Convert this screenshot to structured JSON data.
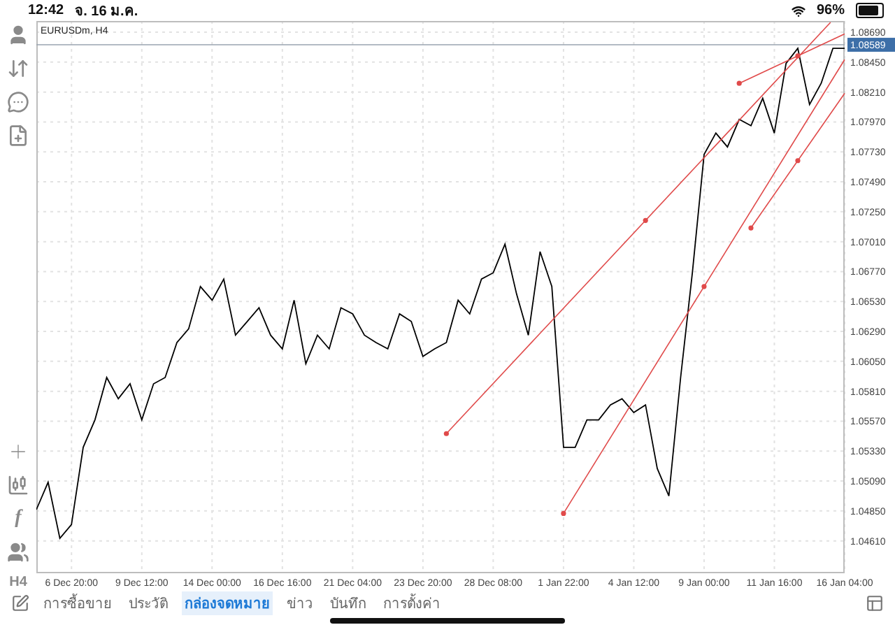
{
  "status_bar": {
    "time": "12:42",
    "date": "จ. 16 ม.ค.",
    "battery": "96%"
  },
  "left_toolbar": {
    "function_label": "f",
    "timeframe": "H4"
  },
  "chart": {
    "title": "EURUSDm, H4",
    "chart_data": {
      "type": "line",
      "ylim": [
        1.0435,
        1.0878
      ],
      "grid": true,
      "ref_lines": [
        {
          "axis": "y",
          "value": 1.08589,
          "label": "1.08589",
          "color": "#9aa5b0"
        }
      ],
      "categories": [
        null,
        null,
        null,
        "6 Dec 20:00",
        null,
        null,
        null,
        null,
        null,
        "9 Dec 12:00",
        null,
        null,
        null,
        null,
        null,
        "14 Dec 00:00",
        null,
        null,
        null,
        null,
        null,
        "16 Dec 16:00",
        null,
        null,
        null,
        null,
        null,
        "21 Dec 04:00",
        null,
        null,
        null,
        null,
        null,
        "23 Dec 20:00",
        null,
        null,
        null,
        null,
        null,
        "28 Dec 08:00",
        null,
        null,
        null,
        null,
        null,
        "1 Jan 22:00",
        null,
        null,
        null,
        null,
        null,
        "4 Jan 12:00",
        null,
        null,
        null,
        null,
        null,
        "9 Jan 00:00",
        null,
        null,
        null,
        null,
        null,
        "11 Jan 16:00",
        null,
        null,
        null,
        null,
        null,
        "16 Jan 04:00"
      ],
      "series": [
        {
          "color": "#000000",
          "values": [
            1.0486,
            1.0508,
            1.0463,
            1.0474,
            1.0536,
            1.0558,
            1.0592,
            1.0575,
            1.0587,
            1.0558,
            1.0587,
            1.0592,
            1.062,
            1.0631,
            1.0665,
            1.0654,
            1.0671,
            1.0626,
            1.0637,
            1.0648,
            1.0626,
            1.0615,
            1.0654,
            1.0603,
            1.0626,
            1.0615,
            1.0648,
            1.0643,
            1.0626,
            1.062,
            1.0615,
            1.0643,
            1.0637,
            1.0609,
            1.0615,
            1.062,
            1.0654,
            1.0643,
            1.0671,
            1.0676,
            1.0699,
            1.0659,
            1.0626,
            1.0693,
            1.0665,
            1.0536,
            1.0536,
            1.0558,
            1.0558,
            1.057,
            1.0575,
            1.0564,
            1.057,
            1.0519,
            1.0497,
            1.0592,
            1.0676,
            1.0771,
            1.0788,
            1.0777,
            1.0799,
            1.0794,
            1.0816,
            1.0788,
            1.0844,
            1.0856,
            1.0811,
            1.0828,
            1.0856,
            1.0856
          ]
        },
        {
          "color": "#e04a4a",
          "marker": true,
          "values": [
            null,
            null,
            null,
            null,
            null,
            null,
            null,
            null,
            null,
            null,
            null,
            null,
            null,
            null,
            null,
            null,
            null,
            null,
            null,
            null,
            null,
            null,
            null,
            null,
            null,
            null,
            null,
            null,
            null,
            null,
            null,
            null,
            null,
            null,
            null,
            1.0547,
            null,
            null,
            null,
            null,
            null,
            null,
            null,
            null,
            null,
            null,
            null,
            null,
            null,
            null,
            null,
            null,
            1.0718,
            null,
            null,
            null,
            null,
            null,
            null,
            null,
            null,
            null,
            null,
            null,
            null,
            null,
            null,
            null,
            null,
            null
          ]
        },
        {
          "color": "#e04a4a",
          "marker": true,
          "values": [
            null,
            null,
            null,
            null,
            null,
            null,
            null,
            null,
            null,
            null,
            null,
            null,
            null,
            null,
            null,
            null,
            null,
            null,
            null,
            null,
            null,
            null,
            null,
            null,
            null,
            null,
            null,
            null,
            null,
            null,
            null,
            null,
            null,
            null,
            null,
            null,
            null,
            null,
            null,
            null,
            null,
            null,
            null,
            null,
            null,
            null,
            null,
            null,
            null,
            null,
            null,
            null,
            null,
            null,
            null,
            null,
            null,
            null,
            null,
            null,
            1.0828,
            null,
            null,
            null,
            null,
            1.085,
            null,
            null,
            null,
            null
          ]
        },
        {
          "color": "#e04a4a",
          "marker": true,
          "values": [
            null,
            null,
            null,
            null,
            null,
            null,
            null,
            null,
            null,
            null,
            null,
            null,
            null,
            null,
            null,
            null,
            null,
            null,
            null,
            null,
            null,
            null,
            null,
            null,
            null,
            null,
            null,
            null,
            null,
            null,
            null,
            null,
            null,
            null,
            null,
            null,
            null,
            null,
            null,
            null,
            null,
            null,
            null,
            null,
            null,
            1.0483,
            null,
            null,
            null,
            null,
            null,
            null,
            null,
            null,
            null,
            null,
            null,
            1.0665,
            null,
            null,
            null,
            null,
            null,
            null,
            null,
            null,
            null,
            null,
            null,
            null
          ]
        },
        {
          "color": "#e04a4a",
          "marker": true,
          "values": [
            null,
            null,
            null,
            null,
            null,
            null,
            null,
            null,
            null,
            null,
            null,
            null,
            null,
            null,
            null,
            null,
            null,
            null,
            null,
            null,
            null,
            null,
            null,
            null,
            null,
            null,
            null,
            null,
            null,
            null,
            null,
            null,
            null,
            null,
            null,
            null,
            null,
            null,
            null,
            null,
            null,
            null,
            null,
            null,
            null,
            null,
            null,
            null,
            null,
            null,
            null,
            null,
            null,
            null,
            null,
            null,
            null,
            null,
            null,
            null,
            null,
            1.0712,
            null,
            null,
            null,
            1.0766,
            null,
            null,
            null,
            null
          ]
        }
      ],
      "yticks": [
        {
          "value": 1.0869,
          "label": "1.08690"
        },
        {
          "value": 1.0845,
          "label": "1.08450"
        },
        {
          "value": 1.0821,
          "label": "1.08210"
        },
        {
          "value": 1.0797,
          "label": "1.07970"
        },
        {
          "value": 1.0773,
          "label": "1.07730"
        },
        {
          "value": 1.0749,
          "label": "1.07490"
        },
        {
          "value": 1.0725,
          "label": "1.07250"
        },
        {
          "value": 1.0701,
          "label": "1.07010"
        },
        {
          "value": 1.0677,
          "label": "1.06770"
        },
        {
          "value": 1.0653,
          "label": "1.06530"
        },
        {
          "value": 1.0629,
          "label": "1.06290"
        },
        {
          "value": 1.0605,
          "label": "1.06050"
        },
        {
          "value": 1.0581,
          "label": "1.05810"
        },
        {
          "value": 1.0557,
          "label": "1.05570"
        },
        {
          "value": 1.0533,
          "label": "1.05330"
        },
        {
          "value": 1.0509,
          "label": "1.05090"
        },
        {
          "value": 1.0485,
          "label": "1.04850"
        },
        {
          "value": 1.0461,
          "label": "1.04610"
        }
      ]
    }
  },
  "tabs": [
    {
      "label": "การซื้อขาย",
      "selected": false
    },
    {
      "label": "ประวัติ",
      "selected": false
    },
    {
      "label": "กล่องจดหมาย",
      "selected": true
    },
    {
      "label": "ข่าว",
      "selected": false
    },
    {
      "label": "บันทึก",
      "selected": false
    },
    {
      "label": "การตั้งค่า",
      "selected": false
    }
  ]
}
